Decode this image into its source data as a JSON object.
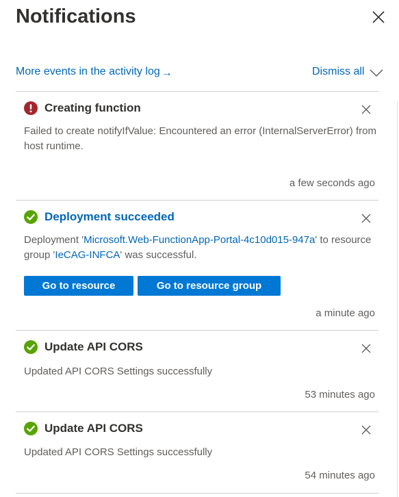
{
  "header": {
    "title": "Notifications"
  },
  "toolbar": {
    "activity_link": "More events in the activity log",
    "activity_arrow": "→",
    "dismiss_all": "Dismiss all"
  },
  "notifications": [
    {
      "status": "error",
      "title": "Creating function",
      "message": "Failed to create notifyIfValue: Encountered an error (InternalServerError) from host runtime.",
      "time": "a few seconds ago"
    },
    {
      "status": "success",
      "title": "Deployment succeeded",
      "message_prefix": "Deployment '",
      "deployment_name": "Microsoft.Web-FunctionApp-Portal-4c10d015-947a",
      "message_middle": "' to resource group '",
      "resource_group": "IeCAG-INFCA",
      "message_suffix": "' was successful.",
      "button_primary": "Go to resource",
      "button_secondary": "Go to resource group",
      "time": "a minute ago"
    },
    {
      "status": "success",
      "title": "Update API CORS",
      "message": "Updated API CORS Settings successfully",
      "time": "53 minutes ago"
    },
    {
      "status": "success",
      "title": "Update API CORS",
      "message": "Updated API CORS Settings successfully",
      "time": "54 minutes ago"
    }
  ],
  "icons": {
    "error_color": "#a4262c",
    "success_color": "#57a300",
    "link_color": "#0067b8",
    "button_color": "#0078d4"
  }
}
